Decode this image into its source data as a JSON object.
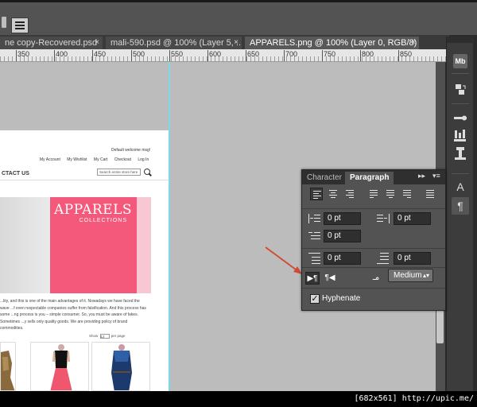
{
  "tabs": [
    {
      "label": "ne copy-Recovered.psd",
      "close": "×"
    },
    {
      "label": "mali-590.psd @ 100% (Layer 5, ...",
      "close": "×"
    },
    {
      "label": "APPARELS.png @ 100% (Layer 0, RGB/8) *",
      "close": "×"
    }
  ],
  "ruler": {
    "labels": [
      "350",
      "400",
      "450",
      "500",
      "550",
      "600",
      "650",
      "700",
      "750",
      "800",
      "850"
    ]
  },
  "page": {
    "welcome": "Default welcome msg!",
    "account_links": [
      "My Account",
      "My Wishlist",
      "My Cart",
      "Checkout",
      "Log In"
    ],
    "nav_contact": "CTACT US",
    "search_placeholder": "Search entire store here",
    "banner_title": "APPARELS",
    "banner_sub": "COLLECTIONS",
    "paragraph": "...lity, and this is one of the main advantages of it. Nowadays we have faced the wave ...f even respectable companies suffer from falsification. And this process has some ...ng process is you – simple consumer. So, you must be aware of fakes. Sometimes ...y sells only quality goods. We are providing policy of brand commodities.",
    "show_label": "Show",
    "show_value": "12",
    "per_page": "per page"
  },
  "dock": {
    "mb_label": "Mb",
    "char_icon": "A",
    "para_icon": "¶"
  },
  "panel": {
    "tab_character": "Character",
    "tab_paragraph": "Paragraph",
    "collapse_icon": "▸▸",
    "menu_icon": "▾≡",
    "left_indent": "0 pt",
    "right_indent": "0 pt",
    "first_line_indent": "0 pt",
    "space_before": "0 pt",
    "space_after": "0 pt",
    "ltr_glyph": "▶¶",
    "rtl_glyph": "¶◀",
    "justification_glyph": "مـ",
    "justification_value": "Medium",
    "hyphenate_label": "Hyphenate",
    "hyphenate_checked": true,
    "check_glyph": "✓"
  },
  "watermark": "[682x561] http://upic.me/",
  "colors": {
    "banner_pink": "#f4587a",
    "guide": "#7fd8e8",
    "arrow": "#d24a36"
  }
}
